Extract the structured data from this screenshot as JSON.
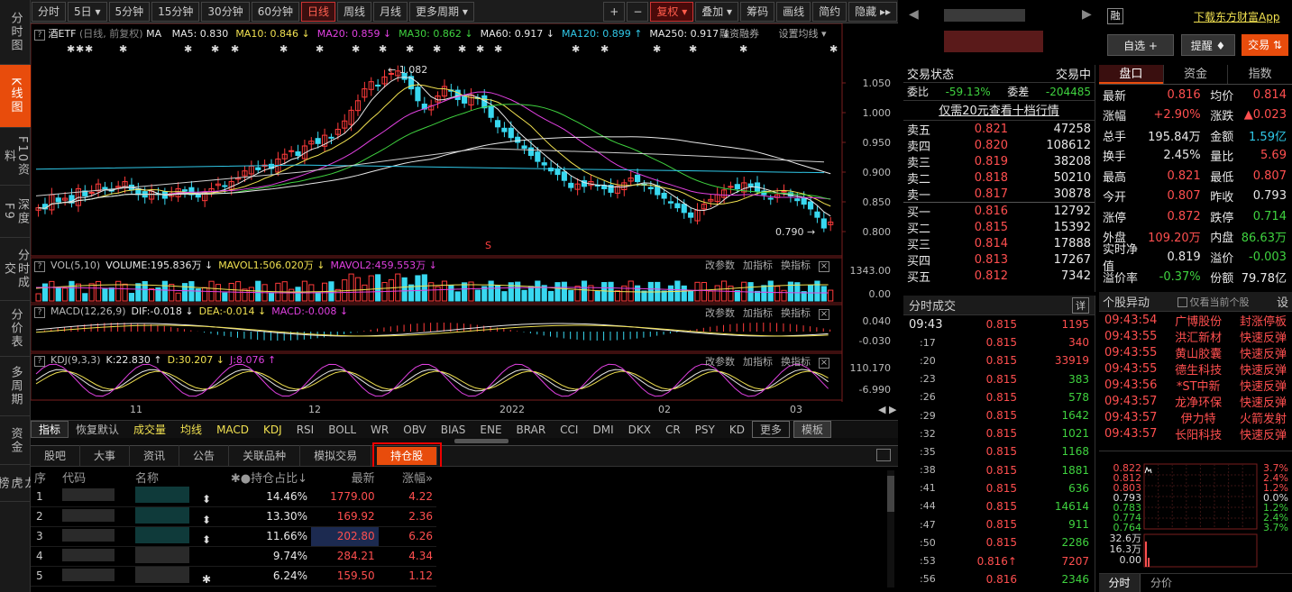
{
  "leftnav": [
    {
      "label": "分时图",
      "active": false
    },
    {
      "label": "K线图",
      "active": true
    },
    {
      "label": "F10资料",
      "active": false
    },
    {
      "label": "深度F9",
      "active": false
    },
    {
      "label": "分时成交",
      "active": false
    },
    {
      "label": "分价表",
      "active": false
    },
    {
      "label": "多周期",
      "active": false
    },
    {
      "label": "资金",
      "active": false
    },
    {
      "label": "龙虎榜",
      "active": false
    }
  ],
  "toolbar": {
    "periods": [
      "分时",
      "5日 ▾",
      "5分钟",
      "15分钟",
      "30分钟",
      "60分钟",
      "日线",
      "周线",
      "月线",
      "更多周期 ▾"
    ],
    "active_period": "日线",
    "right_buttons": [
      "+",
      "−",
      "复权 ▾",
      "叠加 ▾",
      "筹码",
      "画线",
      "简约",
      "隐藏 ▸▸"
    ]
  },
  "chart": {
    "title": "酒ETF",
    "subtitle": "(日线, 前复权)",
    "ma_label": "MA",
    "ma": [
      {
        "label": "MA5: 0.830",
        "color": "#e8e8e8"
      },
      {
        "label": "MA10: 0.846 ↓",
        "color": "#f0e050"
      },
      {
        "label": "MA20: 0.859 ↓",
        "color": "#e040e0"
      },
      {
        "label": "MA30: 0.862 ↓",
        "color": "#3fd23f"
      },
      {
        "label": "MA60: 0.917 ↓",
        "color": "#e8e8e8"
      },
      {
        "label": "MA120: 0.899 ↑",
        "color": "#30c8e8"
      },
      {
        "label": "MA250: 0.917 ↓",
        "color": "#e8e8e8"
      }
    ],
    "links": [
      "融资融券",
      "设置均线 ▾"
    ],
    "price_axis": [
      "1.050",
      "1.000",
      "0.950",
      "0.900",
      "0.850",
      "0.800"
    ],
    "high_label": "1.082",
    "low_label": "0.790",
    "x_labels": [
      "11",
      "12",
      "2022",
      "02",
      "03"
    ],
    "marker_s": "S"
  },
  "vol": {
    "label": "VOL(5,10)",
    "v": "VOLUME:195.836万 ↓",
    "m1": "MAVOL1:506.020万 ↓",
    "m2": "MAVOL2:459.553万 ↓",
    "axis": [
      "1343.00",
      "0.00"
    ],
    "links": [
      "改参数",
      "加指标",
      "换指标"
    ]
  },
  "macd": {
    "label": "MACD(12,26,9)",
    "dif": "DIF:-0.018 ↓",
    "dea": "DEA:-0.014 ↓",
    "macd": "MACD:-0.008 ↓",
    "axis": [
      "0.040",
      "-0.030"
    ],
    "links": [
      "改参数",
      "加指标",
      "换指标"
    ]
  },
  "kdj": {
    "label": "KDJ(9,3,3)",
    "k": "K:22.830 ↑",
    "d": "D:30.207 ↓",
    "j": "J:8.076 ↑",
    "axis": [
      "110.170",
      "-6.990"
    ],
    "links": [
      "改参数",
      "加指标",
      "换指标"
    ]
  },
  "indicators": [
    "指标",
    "恢复默认",
    "成交量",
    "均线",
    "MACD",
    "KDJ",
    "RSI",
    "BOLL",
    "WR",
    "OBV",
    "BIAS",
    "ENE",
    "BRAR",
    "CCI",
    "DMI",
    "DKX",
    "CR",
    "PSY",
    "KD",
    "更多",
    "模板"
  ],
  "bottom_tabs": [
    "股吧",
    "大事",
    "资讯",
    "公告",
    "关联品种",
    "模拟交易",
    "持仓股"
  ],
  "holdings": {
    "headers": [
      "序",
      "代码",
      "名称",
      "✱●持仓占比↓",
      "最新",
      "涨幅»"
    ],
    "rows": [
      {
        "n": "1",
        "pct": "14.46%",
        "price": "1779.00",
        "chg": "4.22",
        "mark": "⬍"
      },
      {
        "n": "2",
        "pct": "13.30%",
        "price": "169.92",
        "chg": "2.36",
        "mark": "⬍"
      },
      {
        "n": "3",
        "pct": "11.66%",
        "price": "202.80",
        "chg": "6.26",
        "mark": "⬍"
      },
      {
        "n": "4",
        "pct": "9.74%",
        "price": "284.21",
        "chg": "4.34",
        "mark": ""
      },
      {
        "n": "5",
        "pct": "6.24%",
        "price": "159.50",
        "chg": "1.12",
        "mark": "✱"
      }
    ]
  },
  "right": {
    "top_link": "下载东方财富App",
    "tag": "融",
    "btn_watch": "自选 +",
    "btn_alert": "提醒 ♦",
    "btn_trade": "交易 ⇅",
    "status_label": "交易状态",
    "status_val": "交易中",
    "weibi_label": "委比",
    "weibi": "-59.13%",
    "weicha_label": "委差",
    "weicha": "-204485",
    "ten_level": "仅需20元查看十档行情",
    "sells": [
      {
        "l": "卖五",
        "p": "0.821",
        "v": "47258"
      },
      {
        "l": "卖四",
        "p": "0.820",
        "v": "108612"
      },
      {
        "l": "卖三",
        "p": "0.819",
        "v": "38208"
      },
      {
        "l": "卖二",
        "p": "0.818",
        "v": "50210"
      },
      {
        "l": "卖一",
        "p": "0.817",
        "v": "30878"
      }
    ],
    "buys": [
      {
        "l": "买一",
        "p": "0.816",
        "v": "12792"
      },
      {
        "l": "买二",
        "p": "0.815",
        "v": "15392"
      },
      {
        "l": "买三",
        "p": "0.814",
        "v": "17888"
      },
      {
        "l": "买四",
        "p": "0.813",
        "v": "17267"
      },
      {
        "l": "买五",
        "p": "0.812",
        "v": "7342"
      }
    ],
    "tabs": [
      "盘口",
      "资金",
      "指数"
    ],
    "stats": [
      {
        "l": "最新",
        "v": "0.816",
        "c": "r",
        "l2": "均价",
        "v2": "0.814",
        "c2": "r"
      },
      {
        "l": "涨幅",
        "v": "+2.90%",
        "c": "r",
        "l2": "涨跌",
        "v2": "▲0.023",
        "c2": "r"
      },
      {
        "l": "总手",
        "v": "195.84万",
        "c": "w",
        "l2": "金额",
        "v2": "1.59亿",
        "c2": "c"
      },
      {
        "l": "换手",
        "v": "2.45%",
        "c": "w",
        "l2": "量比",
        "v2": "5.69",
        "c2": "r"
      },
      {
        "l": "最高",
        "v": "0.821",
        "c": "r",
        "l2": "最低",
        "v2": "0.807",
        "c2": "r"
      },
      {
        "l": "今开",
        "v": "0.807",
        "c": "r",
        "l2": "昨收",
        "v2": "0.793",
        "c2": "w"
      },
      {
        "l": "涨停",
        "v": "0.872",
        "c": "r",
        "l2": "跌停",
        "v2": "0.714",
        "c2": "g"
      },
      {
        "l": "外盘",
        "v": "109.20万",
        "c": "r",
        "l2": "内盘",
        "v2": "86.63万",
        "c2": "g"
      },
      {
        "l": "实时净值",
        "v": "0.819",
        "c": "w",
        "l2": "溢价",
        "v2": "-0.003",
        "c2": "g"
      },
      {
        "l": "溢价率",
        "v": "-0.37%",
        "c": "g",
        "l2": "份额",
        "v2": "79.78亿",
        "c2": "w"
      }
    ],
    "trades_title": "分时成交",
    "trades_btn": "详",
    "trades": [
      {
        "t": "09:43",
        "p": "0.815",
        "v": "1195",
        "c": "r"
      },
      {
        "t": ":17",
        "p": "0.815",
        "v": "340",
        "c": "r"
      },
      {
        "t": ":20",
        "p": "0.815",
        "v": "33919",
        "c": "r"
      },
      {
        "t": ":23",
        "p": "0.815",
        "v": "383",
        "c": "g"
      },
      {
        "t": ":26",
        "p": "0.815",
        "v": "578",
        "c": "g"
      },
      {
        "t": ":29",
        "p": "0.815",
        "v": "1642",
        "c": "g"
      },
      {
        "t": ":32",
        "p": "0.815",
        "v": "1021",
        "c": "g"
      },
      {
        "t": ":35",
        "p": "0.815",
        "v": "1168",
        "c": "g"
      },
      {
        "t": ":38",
        "p": "0.815",
        "v": "1881",
        "c": "g"
      },
      {
        "t": ":41",
        "p": "0.815",
        "v": "636",
        "c": "g"
      },
      {
        "t": ":44",
        "p": "0.815",
        "v": "14614",
        "c": "g"
      },
      {
        "t": ":47",
        "p": "0.815",
        "v": "911",
        "c": "g"
      },
      {
        "t": ":50",
        "p": "0.815",
        "v": "2286",
        "c": "g"
      },
      {
        "t": ":53",
        "p": "0.816↑",
        "v": "7207",
        "c": "r"
      },
      {
        "t": ":56",
        "p": "0.816",
        "v": "2346",
        "c": "g"
      }
    ],
    "movers_title": "个股异动",
    "movers_opt": "仅看当前个股",
    "movers_btn": "设",
    "movers": [
      {
        "t": "09:43:54",
        "n": "广博股份",
        "e": "封涨停板"
      },
      {
        "t": "09:43:55",
        "n": "洪汇新材",
        "e": "快速反弹"
      },
      {
        "t": "09:43:55",
        "n": "黄山胶囊",
        "e": "快速反弹"
      },
      {
        "t": "09:43:55",
        "n": "德生科技",
        "e": "快速反弹"
      },
      {
        "t": "09:43:56",
        "n": "*ST中新",
        "e": "快速反弹"
      },
      {
        "t": "09:43:57",
        "n": "龙净环保",
        "e": "快速反弹"
      },
      {
        "t": "09:43:57",
        "n": "伊力特",
        "e": "火箭发射"
      },
      {
        "t": "09:43:57",
        "n": "长阳科技",
        "e": "快速反弹"
      }
    ],
    "mini_left": [
      "0.822",
      "0.812",
      "0.803",
      "0.793",
      "0.783",
      "0.774",
      "0.764"
    ],
    "mini_right": [
      "3.7%",
      "2.4%",
      "1.2%",
      "0.0%",
      "1.2%",
      "2.4%",
      "3.7%"
    ],
    "mini_vol": [
      "32.6万",
      "16.3万",
      "0.00"
    ],
    "bottom_tabs": [
      "分时",
      "分价"
    ]
  }
}
